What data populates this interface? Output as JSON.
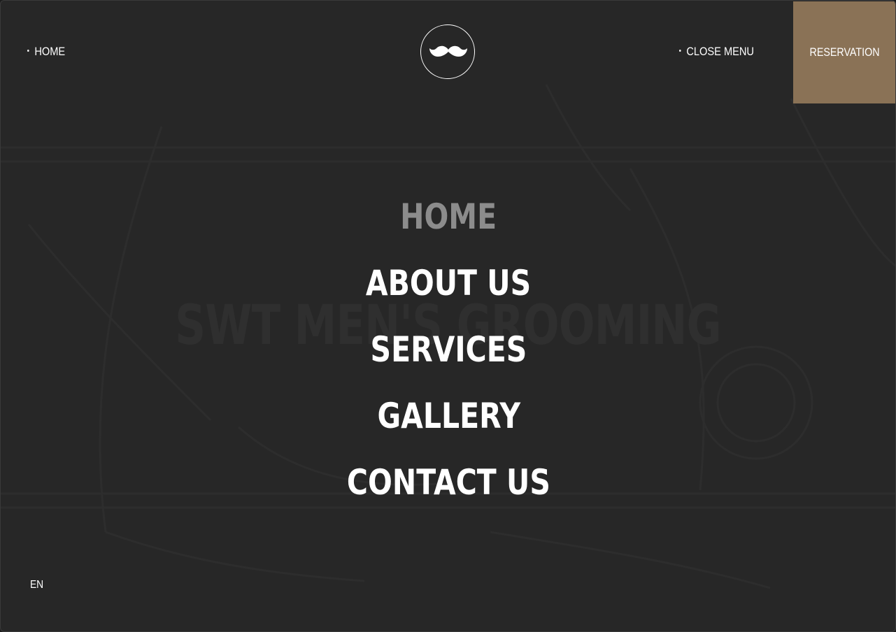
{
  "header": {
    "left_link": "HOME",
    "close_menu": "CLOSE MENU",
    "reservation": "RESERVATION",
    "logo_icon": "mustache-icon"
  },
  "background": {
    "title": "SWT MEN'S GROOMING"
  },
  "menu": {
    "items": [
      {
        "label": "HOME",
        "active": true
      },
      {
        "label": "ABOUT US",
        "active": false
      },
      {
        "label": "SERVICES",
        "active": false
      },
      {
        "label": "GALLERY",
        "active": false
      },
      {
        "label": "CONTACT US",
        "active": false
      }
    ]
  },
  "language": "EN",
  "colors": {
    "background": "#272727",
    "accent": "#8a7256",
    "text": "#ffffff",
    "active_item": "#8c8c8c"
  }
}
